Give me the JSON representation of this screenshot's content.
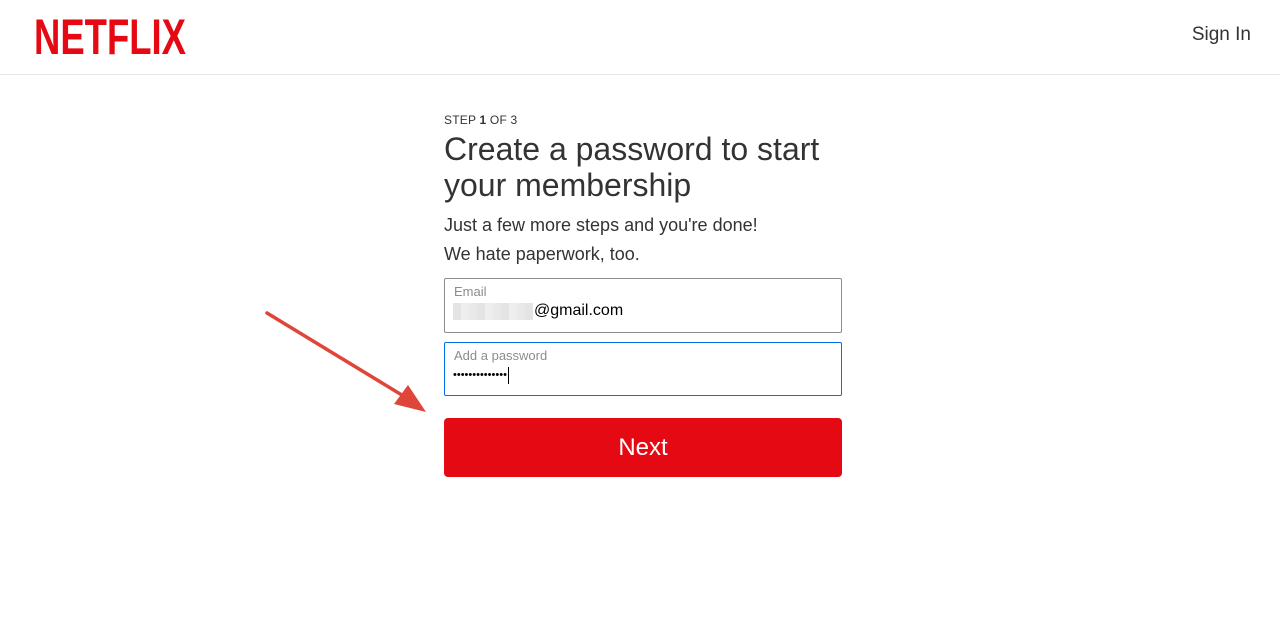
{
  "header": {
    "logo_text": "NETFLIX",
    "signin_label": "Sign In"
  },
  "step": {
    "prefix": "STEP",
    "current": "1",
    "separator": "OF",
    "total": "3"
  },
  "title": "Create a password to start your membership",
  "subtitle_1": "Just a few more steps and you're done!",
  "subtitle_2": "We hate paperwork, too.",
  "email_field": {
    "label": "Email",
    "value_suffix": "@gmail.com"
  },
  "password_field": {
    "label": "Add a password",
    "masked_value": "••••••••••••••"
  },
  "next_button_label": "Next",
  "colors": {
    "brand_red": "#e50914",
    "annotation_arrow": "#e0453a",
    "focus_border": "#0071eb"
  },
  "icons": {
    "annotation": "arrow-annotation-icon"
  }
}
